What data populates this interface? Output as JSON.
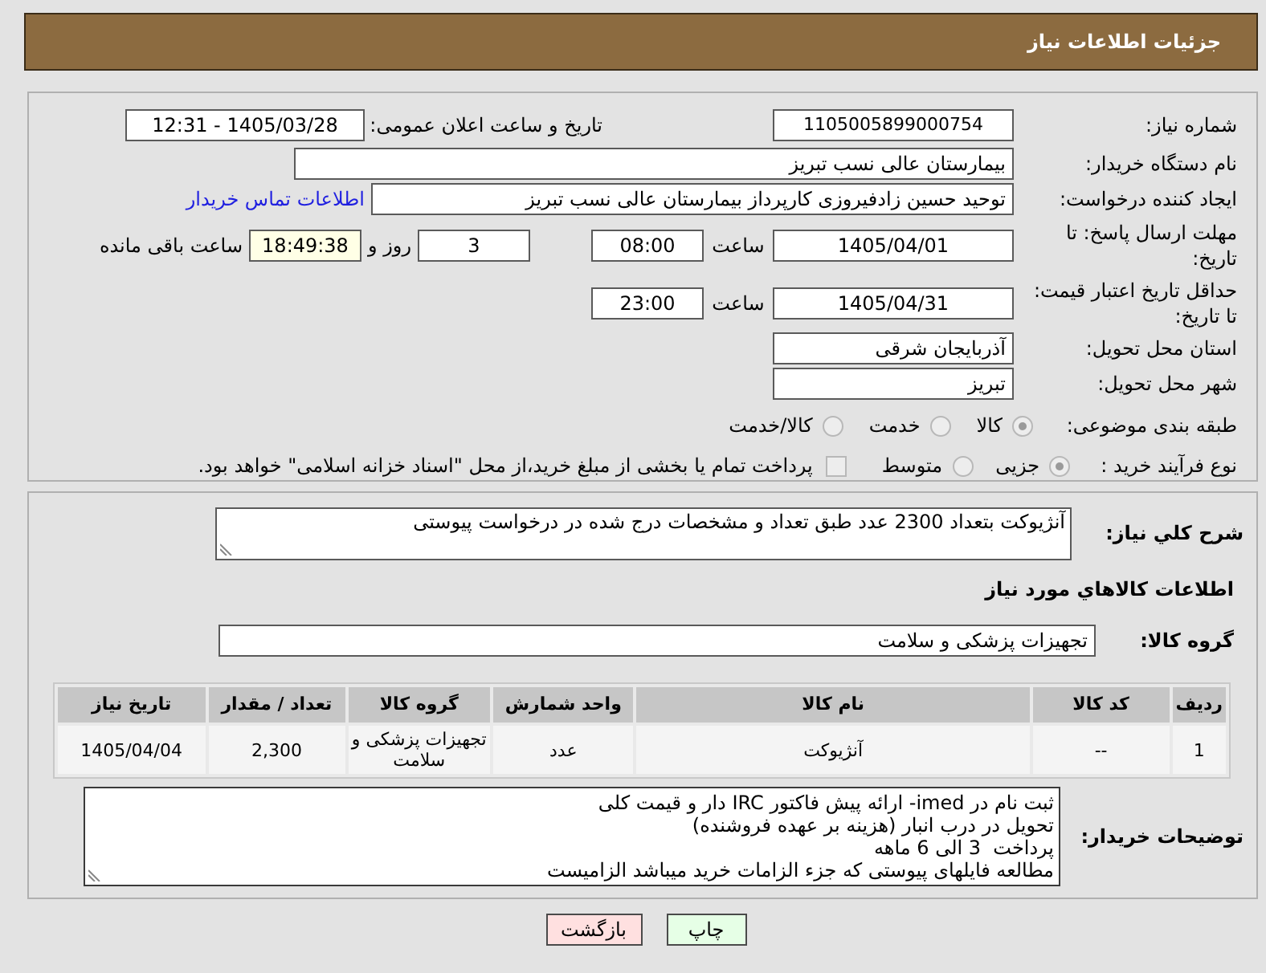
{
  "header": {
    "title": "جزئیات اطلاعات نیاز"
  },
  "details": {
    "need_number": {
      "label": "شماره نیاز:",
      "value": "1105005899000754"
    },
    "announce": {
      "label": "تاریخ و ساعت اعلان عمومی:",
      "value": "1405/03/28 - 12:31"
    },
    "buyer": {
      "label": "نام دستگاه خریدار:",
      "value": "بیمارستان عالی نسب تبریز"
    },
    "creator": {
      "label": "ایجاد کننده درخواست:",
      "value": "توحید حسین زادفیروزی کارپرداز بیمارستان عالی نسب تبریز",
      "link": "اطلاعات تماس خریدار"
    },
    "deadline": {
      "label": "مهلت ارسال پاسخ: تا تاریخ:",
      "date": "1405/04/01",
      "time_label": "ساعت",
      "time": "08:00",
      "days": "3",
      "days_label": "روز و",
      "remaining": "18:49:38",
      "remaining_label": "ساعت باقی مانده"
    },
    "validity": {
      "label": "حداقل تاریخ اعتبار قیمت: تا تاریخ:",
      "date": "1405/04/31",
      "time_label": "ساعت",
      "time": "23:00"
    },
    "province": {
      "label": "استان محل تحویل:",
      "value": "آذربایجان شرقی"
    },
    "city": {
      "label": "شهر محل تحویل:",
      "value": "تبریز"
    },
    "category": {
      "label": "طبقه بندی موضوعی:",
      "options": [
        {
          "label": "کالا",
          "selected": true
        },
        {
          "label": "خدمت",
          "selected": false
        },
        {
          "label": "کالا/خدمت",
          "selected": false
        }
      ]
    },
    "process": {
      "label": "نوع فرآیند خرید :",
      "options": [
        {
          "label": "جزیی",
          "selected": true
        },
        {
          "label": "متوسط",
          "selected": false
        }
      ],
      "treasury": {
        "label": "پرداخت تمام یا بخشی از مبلغ خرید،از محل \"اسناد خزانه اسلامی\" خواهد بود.",
        "checked": false
      }
    }
  },
  "need": {
    "description_label": "شرح کلي نیاز:",
    "description": "آنژیوکت بتعداد 2300 عدد طبق تعداد و مشخصات درج شده در درخواست پیوستی",
    "goods_title": "اطلاعات کالاهاي مورد نیاز",
    "group_label": "گروه کالا:",
    "group": "تجهیزات پزشکی و سلامت",
    "table": {
      "columns": [
        "ردیف",
        "کد کالا",
        "نام کالا",
        "واحد شمارش",
        "گروه کالا",
        "تعداد / مقدار",
        "تاریخ نیاز"
      ],
      "rows": [
        [
          "1",
          "--",
          "آنژیوکت",
          "عدد",
          "تجهیزات پزشکی و سلامت",
          "2,300",
          "1405/04/04"
        ]
      ]
    },
    "notes_label": "توضیحات خریدار:",
    "notes": [
      "ثبت نام در imed- ارائه پیش فاکتور IRC دار و قیمت کلی",
      "تحویل در درب انبار (هزینه بر عهده فروشنده)",
      "پرداخت  3 الی 6 ماهه",
      "مطالعه فایلهای پیوستی که جزء الزامات خرید میباشد الزامیست"
    ]
  },
  "buttons": [
    {
      "label": "چاپ",
      "kind": "print"
    },
    {
      "label": "بازگشت",
      "kind": "back"
    }
  ]
}
